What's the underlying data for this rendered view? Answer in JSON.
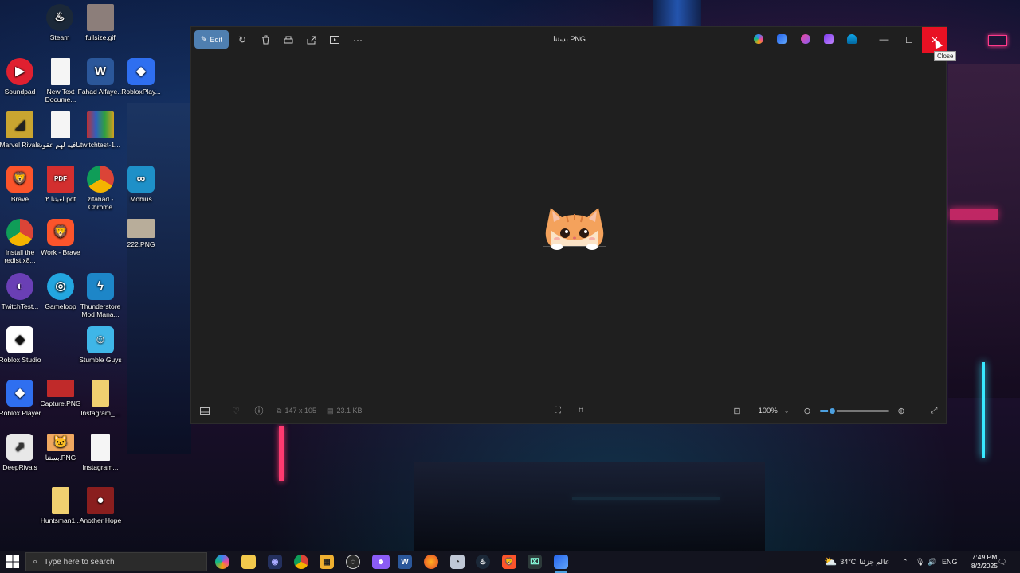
{
  "desktop": {
    "icons": [
      {
        "label": "Steam"
      },
      {
        "label": "fullsize.gif"
      },
      {
        "label": "Soundpad"
      },
      {
        "label": "New Text Docume..."
      },
      {
        "label": "Fahad Alfaye..."
      },
      {
        "label": "RobloxPlay..."
      },
      {
        "label": "Marvel Rivals"
      },
      {
        "label": "مافيه لهم عقود"
      },
      {
        "label": "twitchtest-1..."
      },
      {
        "label": "Brave"
      },
      {
        "label": "لعبتنا ٢.pdf"
      },
      {
        "label": "zifahad - Chrome"
      },
      {
        "label": "Mobius"
      },
      {
        "label": "Install the redist.x8..."
      },
      {
        "label": "Work - Brave"
      },
      {
        "label": "222.PNG"
      },
      {
        "label": "TwitchTest..."
      },
      {
        "label": "Gameloop"
      },
      {
        "label": "Thunderstore Mod Mana..."
      },
      {
        "label": "Roblox Studio"
      },
      {
        "label": "Stumble Guys"
      },
      {
        "label": "Roblox Player"
      },
      {
        "label": "Capture.PNG"
      },
      {
        "label": "Instagram_..."
      },
      {
        "label": "DeepRivals"
      },
      {
        "label": "بستنا.PNG"
      },
      {
        "label": "Instagram..."
      },
      {
        "label": "Huntsman1..."
      },
      {
        "label": "Another Hope"
      }
    ]
  },
  "photos": {
    "title": "بستنا.PNG",
    "edit_label": "Edit",
    "close_tooltip": "Close",
    "dimensions": "147 x 105",
    "file_size": "23.1 KB",
    "zoom": "100%",
    "zoom_slider_fraction": 0.18
  },
  "taskbar": {
    "search_placeholder": "Type here to search",
    "weather": "34°C",
    "weather_location": "عالم جزئنا",
    "language": "ENG",
    "time": "7:49 PM",
    "date": "8/2/2025"
  },
  "colors": {
    "window_bg": "#1f1f1f",
    "accent": "#4ca0e0",
    "close_red": "#e81123",
    "edit_button": "#4f7fb0"
  }
}
